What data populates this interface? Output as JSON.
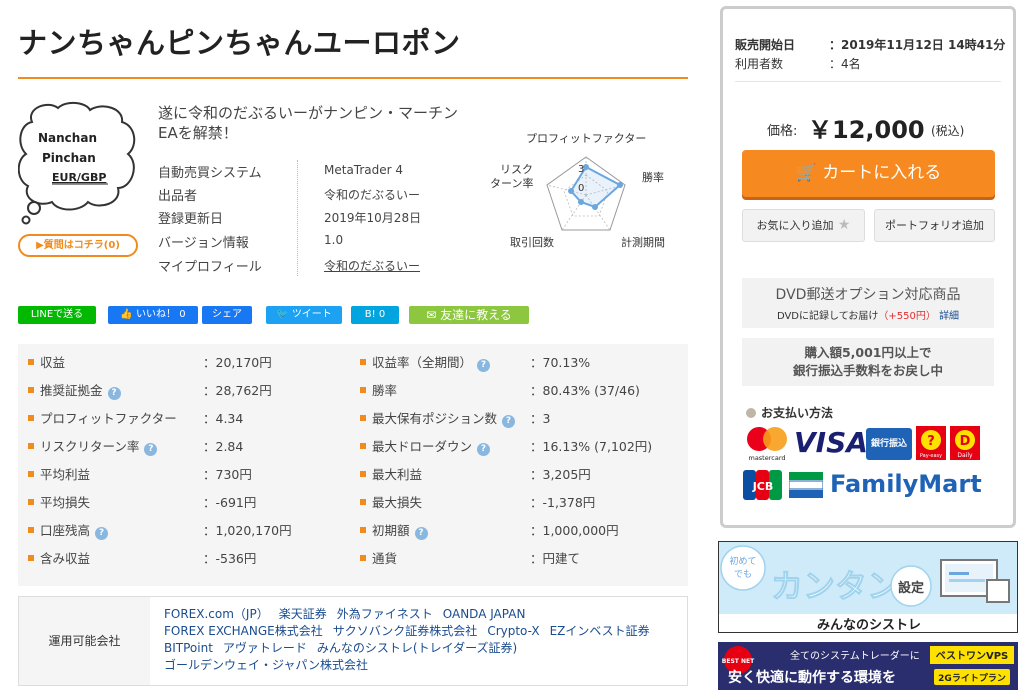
{
  "product": {
    "title": "ナンちゃんピンちゃんユーロポン",
    "logo_lines": [
      "Nanchan",
      "Pinchan",
      "EUR/GBP"
    ],
    "qa_button": "質問はコチラ(0)",
    "catch_copy": "遂に令和のだぶるいーがナンピン・マーチンEAを解禁！"
  },
  "info": {
    "rows": [
      {
        "label": "自動売買システム",
        "value": "MetaTrader 4"
      },
      {
        "label": "出品者",
        "value": "令和のだぶるいー"
      },
      {
        "label": "登録更新日",
        "value": "2019年10月28日"
      },
      {
        "label": "バージョン情報",
        "value": "1.0"
      },
      {
        "label": "マイプロフィール",
        "value": "令和のだぶるいー"
      }
    ]
  },
  "radar": {
    "labels": {
      "top": "プロフィットファクター",
      "right": "勝率",
      "bottom_right": "計測期間",
      "bottom_left": "取引回数",
      "left_line1": "リスク",
      "left_line2": "ターン率"
    },
    "scale_labels": [
      "3",
      "0"
    ]
  },
  "share": {
    "line": "LINEで送る",
    "like": "いいね！ 0",
    "fb_share": "シェア",
    "tweet": "ツイート",
    "hatena": "B! 0",
    "friend": "友達に教える"
  },
  "stats": {
    "left": [
      {
        "label": "収益",
        "value": "：20,170円",
        "help": false
      },
      {
        "label": "推奨証拠金",
        "value": "：28,762円",
        "help": true
      },
      {
        "label": "プロフィットファクター",
        "value": "：4.34",
        "help": false
      },
      {
        "label": "リスクリターン率",
        "value": "：2.84",
        "help": true
      },
      {
        "label": "平均利益",
        "value": "：730円",
        "help": false
      },
      {
        "label": "平均損失",
        "value": "：-691円",
        "help": false
      },
      {
        "label": "口座残高",
        "value": "：1,020,170円",
        "help": true
      },
      {
        "label": "含み収益",
        "value": "：-536円",
        "help": false
      }
    ],
    "right": [
      {
        "label": "収益率（全期間）",
        "value": "：70.13%",
        "help": true
      },
      {
        "label": "勝率",
        "value": "：80.43% (37/46)",
        "help": false
      },
      {
        "label": "最大保有ポジション数",
        "value": "：3",
        "help": true
      },
      {
        "label": "最大ドローダウン",
        "value": "：16.13% (7,102円)",
        "help": true
      },
      {
        "label": "最大利益",
        "value": "：3,205円",
        "help": false
      },
      {
        "label": "最大損失",
        "value": "：-1,378円",
        "help": false
      },
      {
        "label": "初期額",
        "value": "：1,000,000円",
        "help": true
      },
      {
        "label": "通貨",
        "value": "：円建て",
        "help": false
      }
    ]
  },
  "brokers": {
    "label": "運用可能会社",
    "items": [
      "FOREX.com（JP）",
      "楽天証券",
      "外為ファイネスト",
      "OANDA JAPAN",
      "FOREX EXCHANGE株式会社",
      "サクソバンク証券株式会社",
      "Crypto-X",
      "EZインベスト証券",
      "BITPoint",
      "アヴァトレード",
      "みんなのシストレ(トレイダーズ証券)",
      "ゴールデンウェイ・ジャパン株式会社"
    ]
  },
  "sidebar": {
    "sale_start_label": "販売開始日",
    "sale_start_value": "：2019年11月12日 14時41分",
    "users_label": "利用者数",
    "users_value": "：4名",
    "price_label": "価格:",
    "price_value": "￥12,000",
    "price_tax": "(税込)",
    "cart_button": "カートに入れる",
    "fav_button": "お気に入り追加",
    "portfolio_button": "ポートフォリオ追加",
    "dvd_title": "DVD郵送オプション対応商品",
    "dvd_sub": "DVDに記録してお届け",
    "dvd_price": "（+550円）",
    "dvd_detail": "詳細",
    "bank_line1": "購入額5,001円以上で",
    "bank_line2": "銀行振込手数料をお戻し中",
    "pay_title": "お支払い方法",
    "payments": [
      "mastercard",
      "VISA",
      "銀行振込",
      "Pay-easy",
      "Daily",
      "JCB",
      "FamilyMart"
    ]
  },
  "banners": {
    "b1_small1": "初めて",
    "b1_small2": "でも",
    "b1_big": "カンタン",
    "b1_setting": "設定",
    "b1_brand": "みんなのシストレ",
    "b2_tag": "BEST NET",
    "b2_text1": "全てのシステムトレーダーに",
    "b2_text2": "安く快適に動作する環境を",
    "b2_brand": "ベストワンVPS",
    "b2_plan": "2Gライトプラン"
  },
  "colors": {
    "accent": "#f08c1e",
    "link": "#1a4c8f",
    "cart": "#f6891f",
    "radar_line": "#6aa6e0"
  }
}
